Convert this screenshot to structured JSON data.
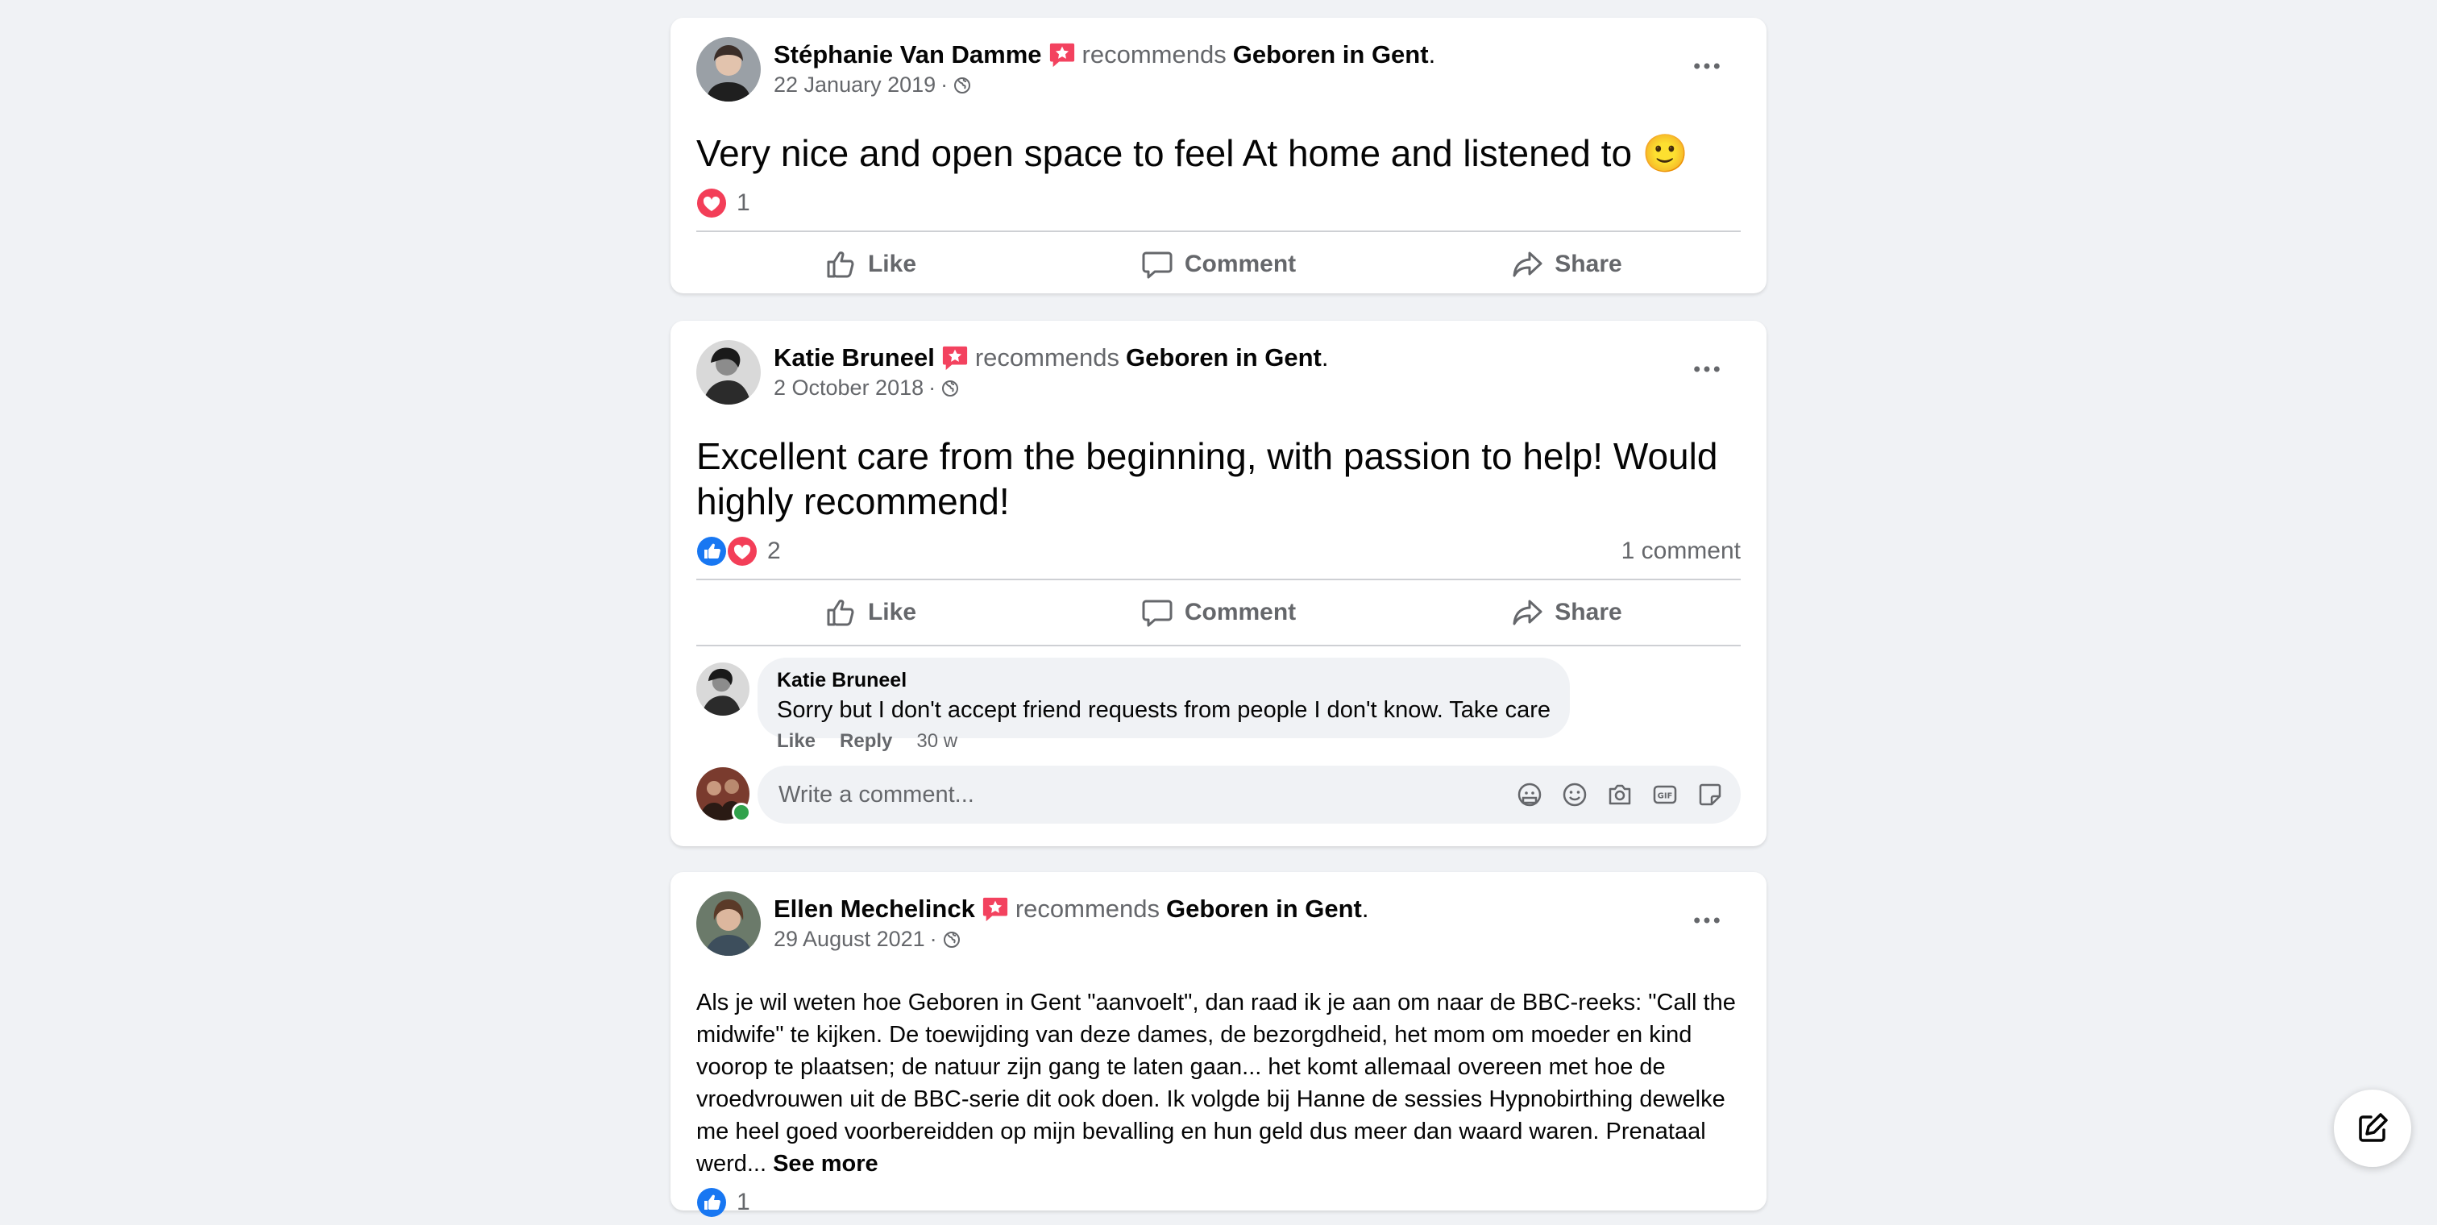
{
  "posts": [
    {
      "author": "Stéphanie Van Damme",
      "recommends_text": "recommends",
      "page_name": "Geboren in Gent",
      "date": "22 January 2019",
      "date_sep": "·",
      "text": "Very nice and open space to feel At home and listened to 🙂",
      "reaction_count": "1"
    },
    {
      "author": "Katie Bruneel",
      "recommends_text": "recommends",
      "page_name": "Geboren in Gent",
      "date": "2 October 2018",
      "date_sep": "·",
      "text": "Excellent care from the beginning, with passion to help! Would highly recommend!",
      "reaction_count": "2",
      "comment_count": "1 comment",
      "comment": {
        "author": "Katie Bruneel",
        "text": "Sorry but I don't accept friend requests from people I don't know. Take care",
        "like": "Like",
        "reply": "Reply",
        "time": "30 w"
      }
    },
    {
      "author": "Ellen Mechelinck",
      "recommends_text": "recommends",
      "page_name": "Geboren in Gent",
      "date": "29 August 2021",
      "date_sep": "·",
      "text": "Als je wil weten hoe Geboren in Gent \"aanvoelt\", dan raad ik je aan om naar de BBC-reeks: \"Call the midwife\" te kijken. De toewijding van deze dames, de bezorgdheid, het mom om moeder en kind voorop te plaatsen; de natuur zijn gang te laten gaan... het komt allemaal overeen met hoe de vroedvrouwen uit de BBC-serie dit ook doen. Ik volgde bij Hanne de sessies Hypnobirthing dewelke me heel goed voorbereidden op mijn bevalling en hun geld dus meer dan waard waren. Prenataal werd...",
      "see_more": "See more",
      "reaction_count": "1"
    }
  ],
  "actions": {
    "like": "Like",
    "comment": "Comment",
    "share": "Share"
  },
  "comment_input": {
    "placeholder": "Write a comment..."
  },
  "colors": {
    "recommend_badge": "#f3425f",
    "like_blue": "#1877f2",
    "love_red": "#f33e58",
    "online_green": "#31a24c"
  }
}
